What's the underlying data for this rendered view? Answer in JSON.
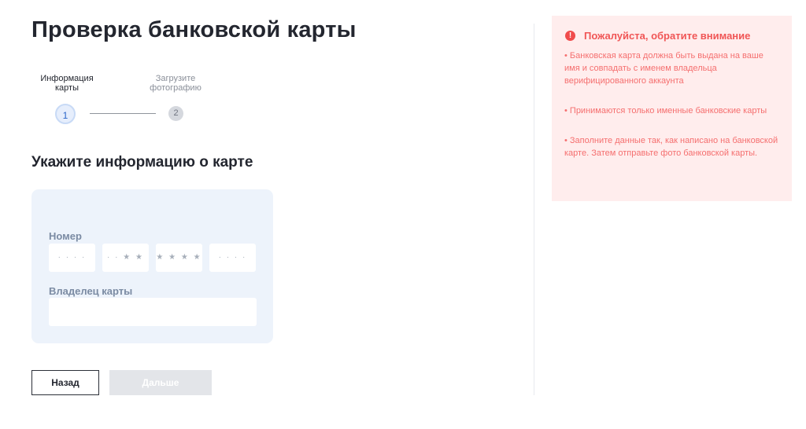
{
  "page": {
    "title": "Проверка банковской карты"
  },
  "stepper": {
    "steps": [
      {
        "label_line1": "Информация",
        "label_line2": "карты",
        "number": "1",
        "status": "active"
      },
      {
        "label_line1": "Загрузите",
        "label_line2": "фотографию",
        "number": "2",
        "status": "inactive"
      }
    ]
  },
  "form": {
    "section_title": "Укажите информацию о карте",
    "number_label": "Номер",
    "number_segments": [
      "· · · ·",
      "· · ★ ★",
      "★ ★ ★ ★",
      "· · · ·"
    ],
    "owner_label": "Владелец карты",
    "owner_value": ""
  },
  "buttons": {
    "back": "Назад",
    "next": "Дальше"
  },
  "notice": {
    "title": "Пожалуйста, обратите внимание",
    "icon": "!",
    "items": [
      "• Банковская карта должна быть выдана на ваше имя и совпадать с именем владельца верифицированного аккаунта",
      "• Принимаются только именные банковские карты",
      "• Заполните данные так, как написано на банковской карте. Затем отправьте фото банковской карты."
    ]
  },
  "colors": {
    "accent_blue": "#2a66c9",
    "notice_bg": "#ffeded",
    "notice_text": "#f56f6f",
    "alert_icon": "#f04b4b",
    "form_bg": "#edf3fb",
    "disabled_button": "#e3e5e9"
  }
}
